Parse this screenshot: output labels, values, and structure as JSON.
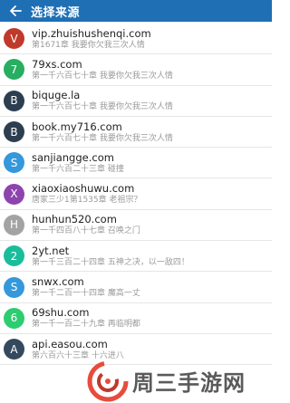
{
  "header": {
    "title": "选择来源"
  },
  "sources": [
    {
      "initial": "V",
      "color": "#c0392b",
      "name": "vip.zhuishushenqi.com",
      "latest": "第1671章 我要你欠我三次人情"
    },
    {
      "initial": "7",
      "color": "#27ae60",
      "name": "79xs.com",
      "latest": "第一千六百七十章 我要你欠我三次人情"
    },
    {
      "initial": "B",
      "color": "#2c3e50",
      "name": "biquge.la",
      "latest": "第一千六百七十章 我要你欠我三次人情"
    },
    {
      "initial": "B",
      "color": "#2c3e50",
      "name": "book.my716.com",
      "latest": "第一千六百七十章 我要你欠我三次人情"
    },
    {
      "initial": "S",
      "color": "#3498db",
      "name": "sanjiangge.com",
      "latest": "第一千六百二十三章 碰撞"
    },
    {
      "initial": "X",
      "color": "#8e44ad",
      "name": "xiaoxiaoshuwu.com",
      "latest": "唐家三少1第1535章 老祖宗？"
    },
    {
      "initial": "H",
      "color": "#a3a3a3",
      "name": "hunhun520.com",
      "latest": "第一千四百八十七章 召唤之门"
    },
    {
      "initial": "2",
      "color": "#1abc9c",
      "name": "2yt.net",
      "latest": "第一千三百二十四章 五神之决，以一敌四！"
    },
    {
      "initial": "S",
      "color": "#3498db",
      "name": "snwx.com",
      "latest": "第一千二百一十四章 魔高一丈"
    },
    {
      "initial": "6",
      "color": "#2ecc71",
      "name": "69shu.com",
      "latest": "第一千一百二十九章 再临明都"
    },
    {
      "initial": "A",
      "color": "#34495e",
      "name": "api.easou.com",
      "latest": "第六百六十三章 十六进八"
    }
  ],
  "watermark": {
    "text": "周三手游网"
  }
}
